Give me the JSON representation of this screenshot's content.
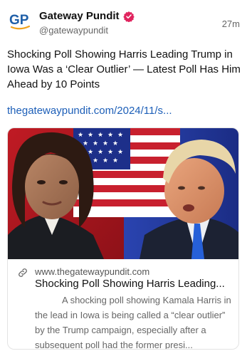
{
  "account": {
    "name": "Gateway Pundit",
    "handle": "@gatewaypundit",
    "avatar_letters": "GP",
    "time": "27m"
  },
  "colors": {
    "verified": "#e0245e",
    "link": "#1d5fb8",
    "avatar_blue": "#1f5fa8",
    "avatar_accent": "#f0a21c"
  },
  "icons": {
    "verified": "verified-badge-icon",
    "link": "link-icon"
  },
  "post": {
    "text": "Shocking Poll Showing Harris Leading Trump in Iowa Was a ‘Clear Outlier’ — Latest Poll Has Him Ahead by 10 Points",
    "link": "thegatewaypundit.com/2024/11/s..."
  },
  "card": {
    "domain": "www.thegatewaypundit.com",
    "title": "Shocking Poll Showing Harris Leading...",
    "description": "A shocking poll showing Kamala Harris in the lead in Iowa is being called a “clear outlier” by the Trump campaign, especially after a subsequent poll had the former presi..."
  }
}
